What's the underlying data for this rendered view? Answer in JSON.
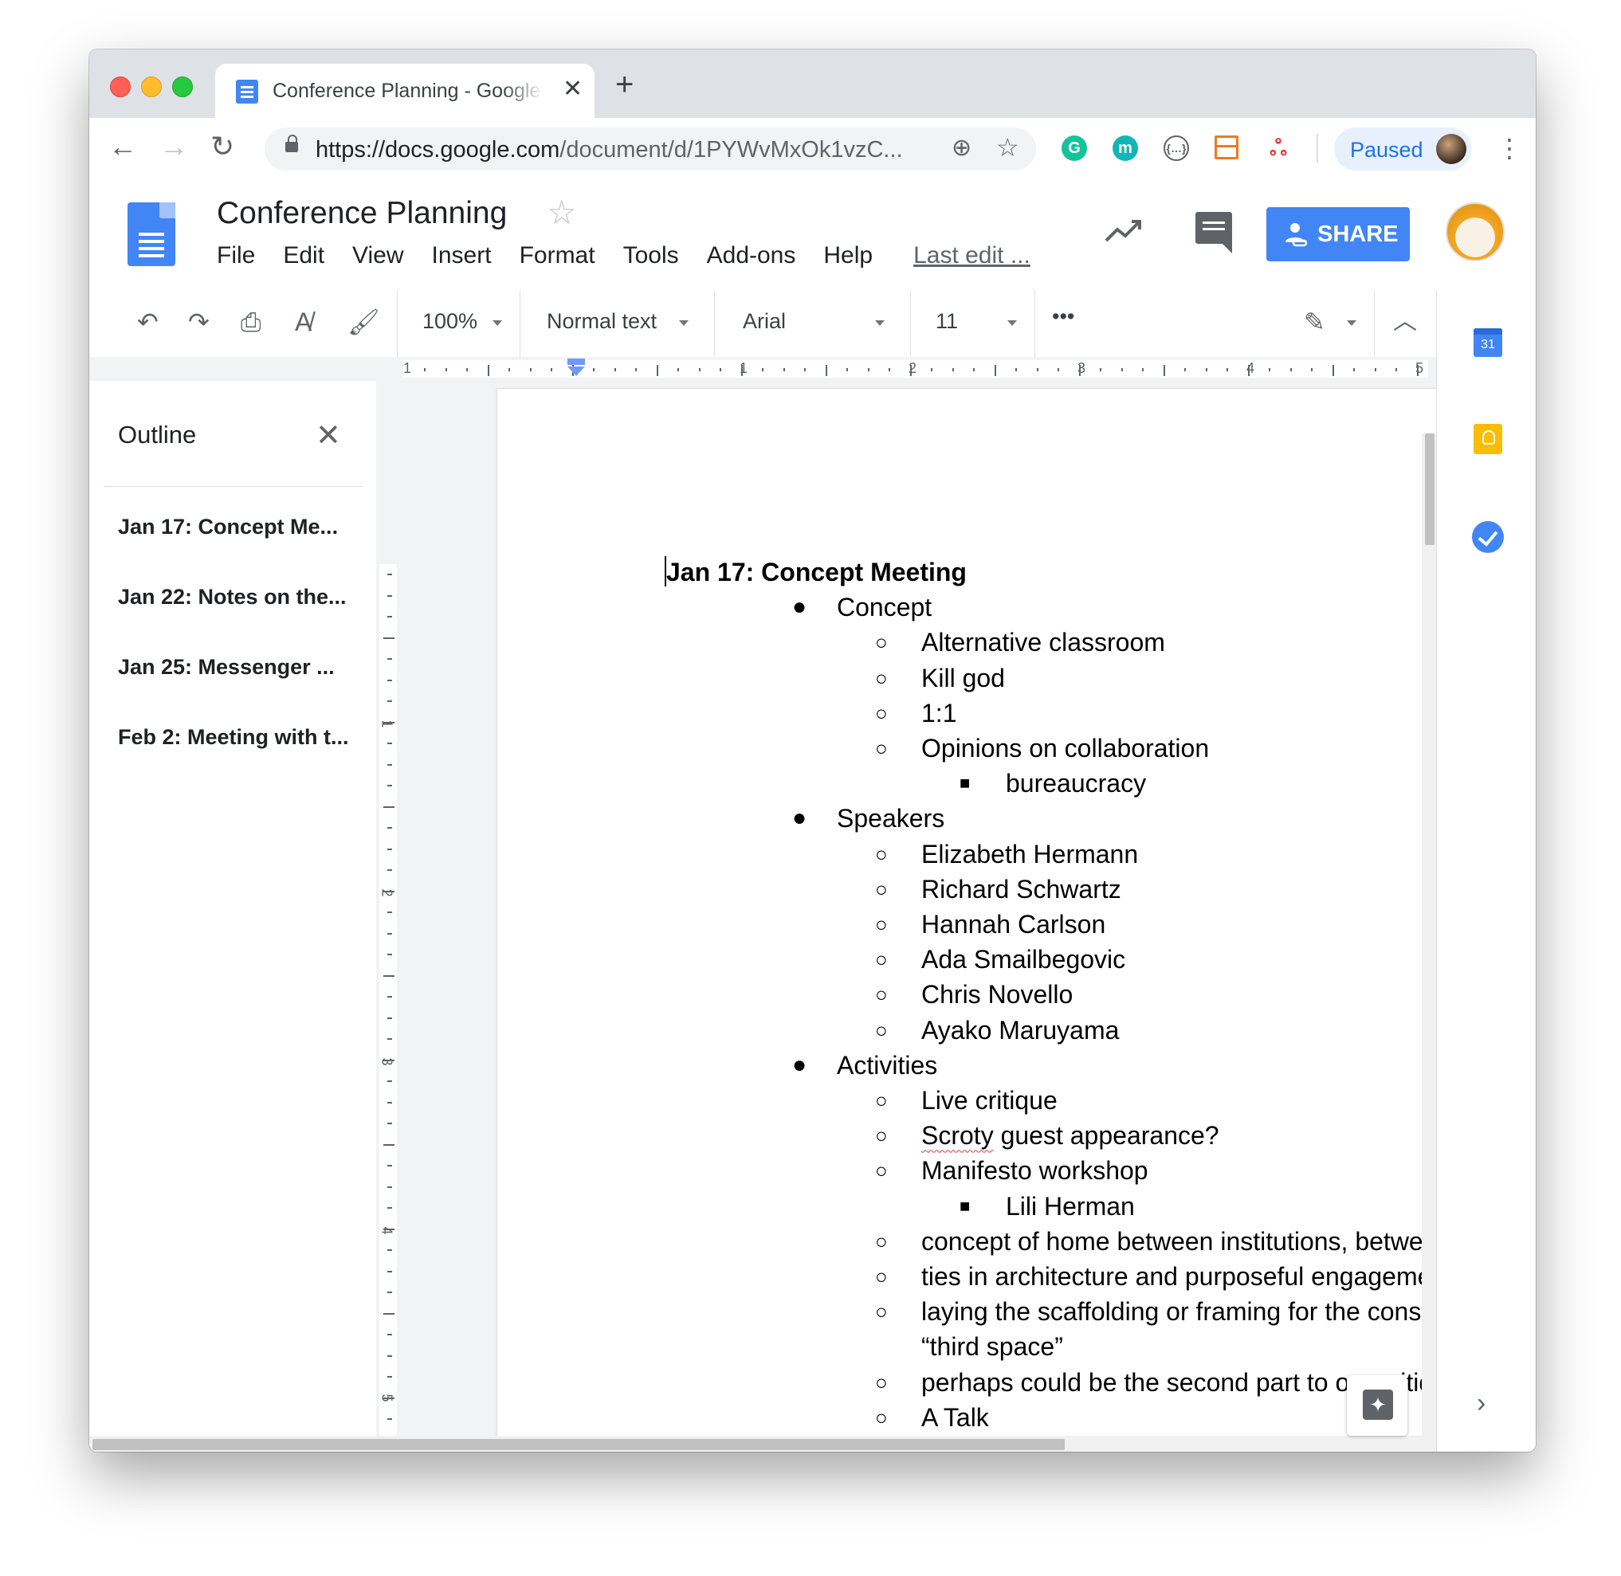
{
  "browser": {
    "tab_title": "Conference Planning - Google Docs",
    "new_tab_icon": "+",
    "url_host": "https://docs.google.com",
    "url_path": "/document/d/1PYWvMxOk1vzC...",
    "profile_status": "Paused"
  },
  "docs": {
    "title": "Conference Planning",
    "menu": [
      "File",
      "Edit",
      "View",
      "Insert",
      "Format",
      "Tools",
      "Add-ons",
      "Help"
    ],
    "last_edit": "Last edit ...",
    "share_label": "SHARE"
  },
  "toolbar": {
    "zoom": "100%",
    "style": "Normal text",
    "font": "Arial",
    "size": "11",
    "more": "•••"
  },
  "ruler": {
    "h_labels": [
      "1",
      "1",
      "2",
      "3",
      "4",
      "5"
    ],
    "v_labels": [
      "1",
      "1",
      "2",
      "3",
      "4",
      "5"
    ]
  },
  "outline": {
    "title": "Outline",
    "items": [
      "Jan 17: Concept Me...",
      "Jan 22: Notes on the...",
      "Jan 25: Messenger ...",
      "Feb 2: Meeting with t..."
    ]
  },
  "document": {
    "heading": "Jan 17: Concept Meeting",
    "lines": [
      {
        "level": 1,
        "bullet": "●",
        "text": "Concept"
      },
      {
        "level": 2,
        "bullet": "○",
        "text": "Alternative classroom"
      },
      {
        "level": 2,
        "bullet": "○",
        "text": "Kill god"
      },
      {
        "level": 2,
        "bullet": "○",
        "text": "1:1"
      },
      {
        "level": 2,
        "bullet": "○",
        "text": "Opinions on collaboration"
      },
      {
        "level": 3,
        "bullet": "■",
        "text": "bureaucracy"
      },
      {
        "level": 1,
        "bullet": "●",
        "text": "Speakers"
      },
      {
        "level": 2,
        "bullet": "○",
        "text": "Elizabeth Hermann"
      },
      {
        "level": 2,
        "bullet": "○",
        "text": "Richard Schwartz"
      },
      {
        "level": 2,
        "bullet": "○",
        "text": "Hannah Carlson"
      },
      {
        "level": 2,
        "bullet": "○",
        "text": "Ada Smailbegovic"
      },
      {
        "level": 2,
        "bullet": "○",
        "text": "Chris Novello"
      },
      {
        "level": 2,
        "bullet": "○",
        "text": "Ayako Maruyama"
      },
      {
        "level": 1,
        "bullet": "●",
        "text": "Activities"
      },
      {
        "level": 2,
        "bullet": "○",
        "text": "Live critique"
      },
      {
        "level": 2,
        "bullet": "○",
        "text": "guest appearance?",
        "misspelled": "Scroty"
      },
      {
        "level": 2,
        "bullet": "○",
        "text": "Manifesto workshop"
      },
      {
        "level": 3,
        "bullet": "■",
        "text": "Lili Herman"
      },
      {
        "level": 2,
        "bullet": "○",
        "text": "concept of home between institutions, between disc"
      },
      {
        "level": 2,
        "bullet": "○",
        "text": "ties in architecture and purposeful engagement"
      },
      {
        "level": 2,
        "bullet": "○",
        "text": "laying the scaffolding or framing for the construction"
      },
      {
        "level": 2,
        "bullet": "",
        "text": "“third space”"
      },
      {
        "level": 2,
        "bullet": "○",
        "text": "perhaps could be the second part to our critique"
      },
      {
        "level": 2,
        "bullet": "○",
        "text": "A Talk"
      }
    ]
  },
  "side_panel": {
    "calendar_day": "31"
  },
  "colors": {
    "accent": "#4285f4",
    "tab_strip": "#dee1e6",
    "canvas": "#f1f3f4"
  }
}
